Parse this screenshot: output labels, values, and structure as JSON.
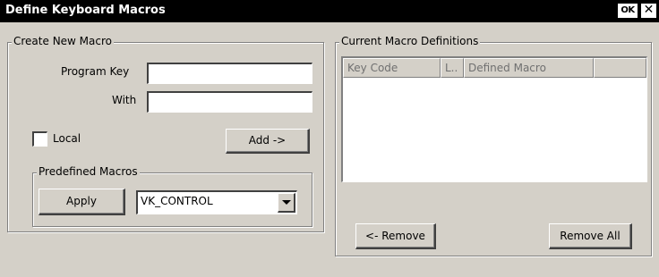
{
  "window": {
    "title": "Define Keyboard Macros",
    "ok_label": "OK",
    "close_label": "✕"
  },
  "create_group": {
    "legend": "Create New Macro",
    "program_key_label": "Program Key",
    "program_key_value": "",
    "with_label": "With",
    "with_value": "",
    "local_label": "Local",
    "local_checked": false,
    "add_label": "Add ->"
  },
  "predefined_group": {
    "legend": "Predefined Macros",
    "apply_label": "Apply",
    "selected_macro": "VK_CONTROL"
  },
  "definitions_group": {
    "legend": "Current Macro Definitions",
    "columns": [
      "Key Code",
      "L..",
      "Defined Macro"
    ],
    "rows": [],
    "remove_label": "<- Remove",
    "remove_all_label": "Remove All"
  }
}
